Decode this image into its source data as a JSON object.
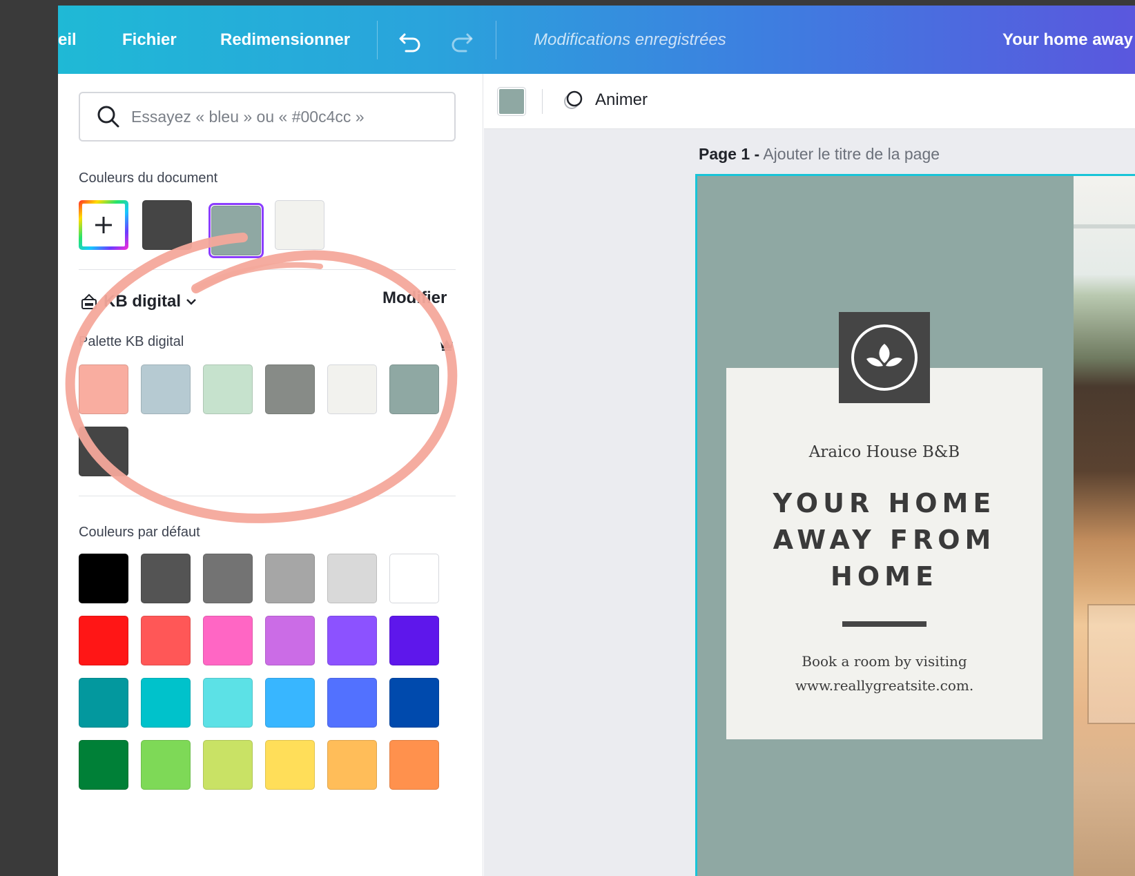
{
  "topbar": {
    "home_label": "eil",
    "file_label": "Fichier",
    "resize_label": "Redimensionner",
    "saved_status": "Modifications enregistrées",
    "design_title": "Your home away"
  },
  "left_panel": {
    "search_placeholder": "Essayez « bleu » ou « #00c4cc »",
    "document_colors_label": "Couleurs du document",
    "document_colors": [
      "#454545",
      "#8fa8a3",
      "#f2f2ee"
    ],
    "brand_kit_label": "KB digital",
    "modify_label": "Modifier",
    "palette_label": "Palette KB digital",
    "palette_colors": [
      "#f9ada0",
      "#b6cad2",
      "#c6e2cd",
      "#878b87",
      "#f2f2ee",
      "#8fa8a3",
      "#454545"
    ],
    "default_colors_label": "Couleurs par défaut",
    "default_colors": [
      "#000000",
      "#545454",
      "#737373",
      "#a6a6a6",
      "#d9d9d9",
      "#ffffff",
      "#ff1616",
      "#ff5757",
      "#ff66c4",
      "#cb6ce6",
      "#8c52ff",
      "#5e17eb",
      "#03989e",
      "#00c2cb",
      "#5ce1e6",
      "#38b6ff",
      "#5271ff",
      "#004aad",
      "#008037",
      "#7ed957",
      "#c9e265",
      "#ffde59",
      "#ffbd59",
      "#ff914d"
    ]
  },
  "canvas": {
    "animate_label": "Animer",
    "page_number_label": "Page 1 -",
    "page_title_placeholder": "Ajouter le titre de la page",
    "design": {
      "business_name": "Araico House B&B",
      "headline_lines": [
        "YOUR HOME",
        "AWAY FROM",
        "HOME"
      ],
      "cta_lines": [
        "Book a room by visiting",
        "www.reallygreatsite.com."
      ]
    }
  },
  "colors": {
    "accent_purple": "#8b3dff",
    "highlight_circle": "#f4a89b",
    "selection_cyan": "#18c4d8"
  }
}
